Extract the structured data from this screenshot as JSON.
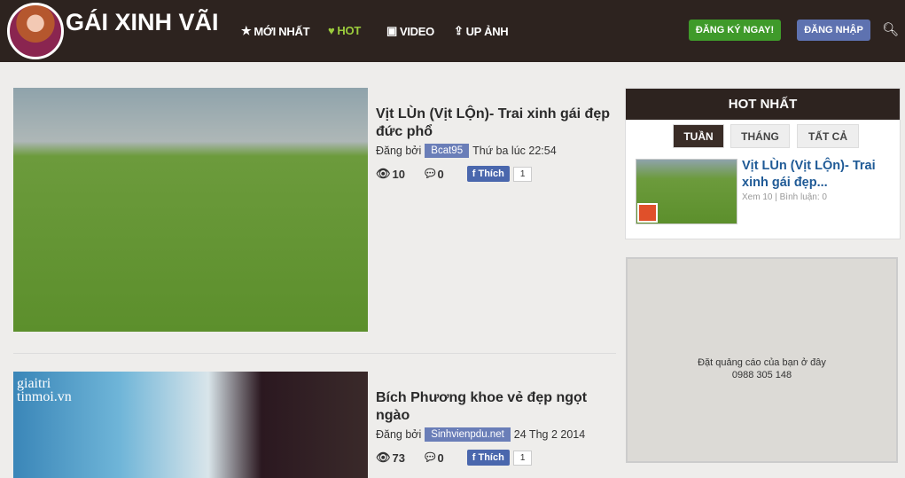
{
  "header": {
    "logo": "GÁI XINH VÃI",
    "nav": [
      {
        "label": "MỚI NHẤT",
        "icon": "star-icon"
      },
      {
        "label": "HOT",
        "icon": "heart-icon"
      },
      {
        "label": "VIDEO",
        "icon": "film-icon"
      },
      {
        "label": "UP ẢNH",
        "icon": "upload-icon"
      }
    ],
    "register": "ĐĂNG KÝ NGAY!",
    "login": "ĐĂNG NHẬP",
    "accent": "#9ccc3c"
  },
  "posts": [
    {
      "title": "Vịt LÙn (Vịt LỘn)- Trai xinh gái đẹp đức phổ",
      "posted_by": "Đăng bởi",
      "user": "Bcat95",
      "time": "Thứ ba lúc 22:54",
      "views": "10",
      "comments": "0",
      "like": "Thích",
      "like_count": "1"
    },
    {
      "title": "Bích Phương khoe vẻ đẹp ngọt ngào",
      "posted_by": "Đăng bởi",
      "user": "Sinhvienpdu.net",
      "time": "24 Thg 2 2014",
      "views": "73",
      "comments": "0",
      "like": "Thích",
      "like_count": "1",
      "watermark": "giaitri tinmoi.vn"
    }
  ],
  "sidebar": {
    "title": "HOT NHẤT",
    "tabs": [
      "TUẦN",
      "THÁNG",
      "TẤT CẢ"
    ],
    "item": {
      "title": "Vịt LÙn (Vịt LỘn)- Trai xinh gái đẹp...",
      "meta": "Xem 10 | Bình luận: 0"
    }
  },
  "ad": {
    "line1": "Đặt quảng cáo của bạn ở đây",
    "line2": "0988 305 148"
  }
}
